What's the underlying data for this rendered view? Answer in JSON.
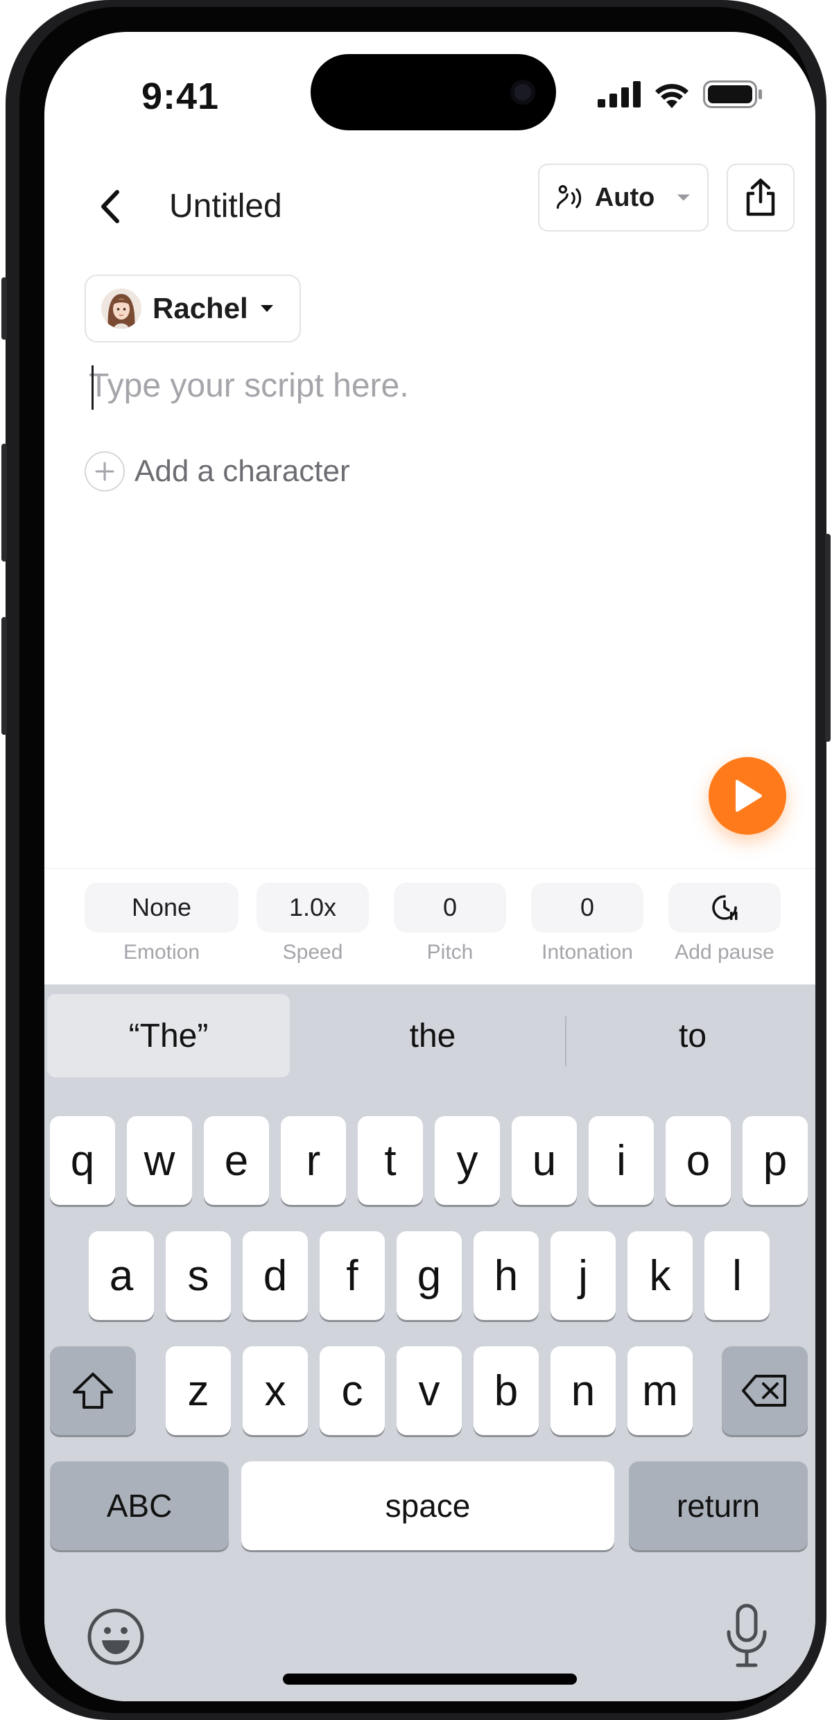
{
  "status_bar": {
    "time": "9:41"
  },
  "header": {
    "title": "Untitled",
    "mode_label": "Auto"
  },
  "character": {
    "name": "Rachel"
  },
  "editor": {
    "placeholder": "Type your script here.",
    "add_character_label": "Add a character"
  },
  "controls": [
    {
      "value": "None",
      "label": "Emotion"
    },
    {
      "value": "1.0x",
      "label": "Speed"
    },
    {
      "value": "0",
      "label": "Pitch"
    },
    {
      "value": "0",
      "label": "Intonation"
    },
    {
      "value": "",
      "label": "Add pause"
    }
  ],
  "keyboard": {
    "suggestions": [
      "“The”",
      "the",
      "to"
    ],
    "row1": [
      "q",
      "w",
      "e",
      "r",
      "t",
      "y",
      "u",
      "i",
      "o",
      "p"
    ],
    "row2": [
      "a",
      "s",
      "d",
      "f",
      "g",
      "h",
      "j",
      "k",
      "l"
    ],
    "row3": [
      "z",
      "x",
      "c",
      "v",
      "b",
      "n",
      "m"
    ],
    "abc_label": "ABC",
    "space_label": "space",
    "return_label": "return"
  },
  "colors": {
    "accent": "#ff7a1a",
    "keyboard_bg": "#d1d5db",
    "special_key": "#abb1ba"
  },
  "icons": [
    "back-arrow-icon",
    "voice-wave-icon",
    "caret-down-icon",
    "share-icon",
    "avatar",
    "plus-icon",
    "play-icon",
    "pause-timer-icon",
    "shift-icon",
    "delete-icon",
    "emoji-icon",
    "microphone-icon"
  ]
}
